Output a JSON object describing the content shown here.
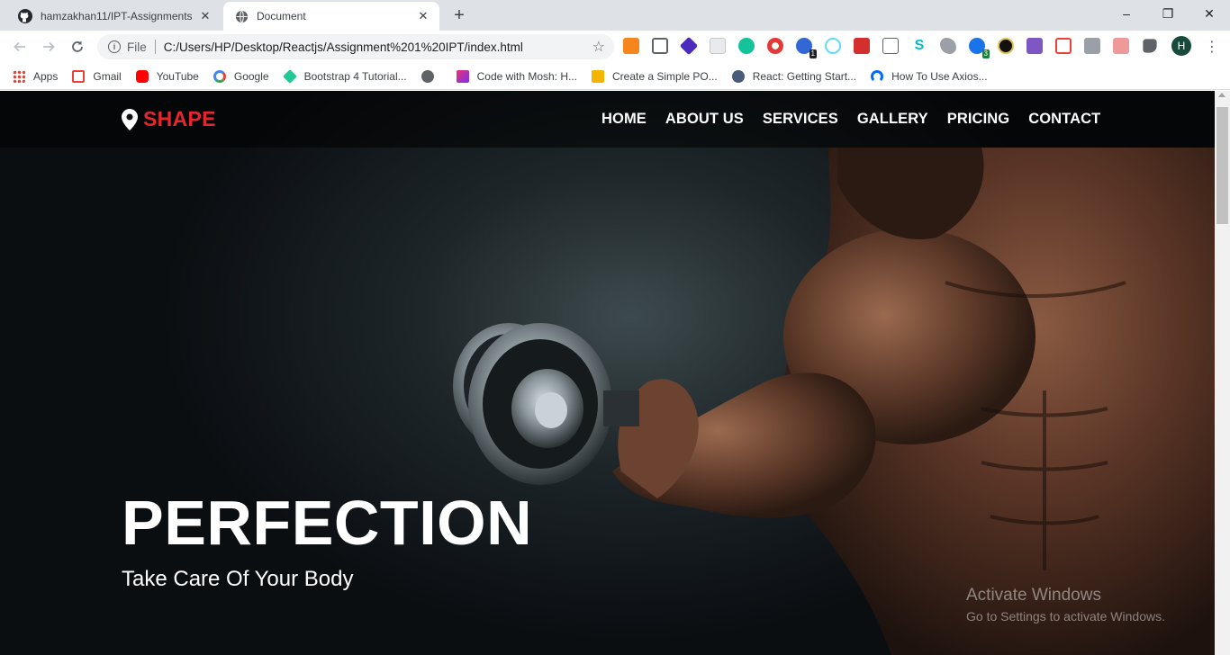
{
  "browser": {
    "tabs": [
      {
        "title": "hamzakhan11/IPT-Assignments",
        "icon": "github-icon"
      },
      {
        "title": "Document",
        "icon": "globe-icon"
      }
    ],
    "new_tab_symbol": "+",
    "window_controls": {
      "minimize": "–",
      "restore": "❐",
      "close": "✕"
    },
    "address_bar": {
      "scheme": "File",
      "url": "C:/Users/HP/Desktop/Reactjs/Assignment%201%20IPT/index.html"
    },
    "extension_badges": {
      "first": "1",
      "second": "3"
    },
    "profile_initial": "H",
    "bookmarks": [
      {
        "label": "Apps",
        "icon": "apps-grid-icon",
        "color": "#ea4335"
      },
      {
        "label": "Gmail",
        "icon": "gmail-icon",
        "color": "#ea4335"
      },
      {
        "label": "YouTube",
        "icon": "youtube-icon",
        "color": "#ff0000"
      },
      {
        "label": "Google",
        "icon": "google-icon",
        "color": "#4285f4"
      },
      {
        "label": "Bootstrap 4 Tutorial...",
        "icon": "bootstrap-icon",
        "color": "#20c997"
      },
      {
        "label": "",
        "icon": "globe-icon",
        "color": "#5f6368"
      },
      {
        "label": "Code with Mosh: H...",
        "icon": "mosh-icon",
        "color": "#e8336d"
      },
      {
        "label": "Create a Simple PO...",
        "icon": "stackify-icon",
        "color": "#f4b400"
      },
      {
        "label": "React: Getting Start...",
        "icon": "datacamp-icon",
        "color": "#4a5a7a"
      },
      {
        "label": "How To Use Axios...",
        "icon": "digitalocean-icon",
        "color": "#0069ff"
      }
    ]
  },
  "site": {
    "brand": "SHAPE",
    "brand_color": "#e5272d",
    "nav": [
      "HOME",
      "ABOUT US",
      "SERVICES",
      "GALLERY",
      "PRICING",
      "CONTACT"
    ],
    "hero": {
      "title": "PERFECTION",
      "subtitle": "Take Care Of Your Body"
    }
  },
  "os_watermark": {
    "line1": "Activate Windows",
    "line2": "Go to Settings to activate Windows."
  }
}
